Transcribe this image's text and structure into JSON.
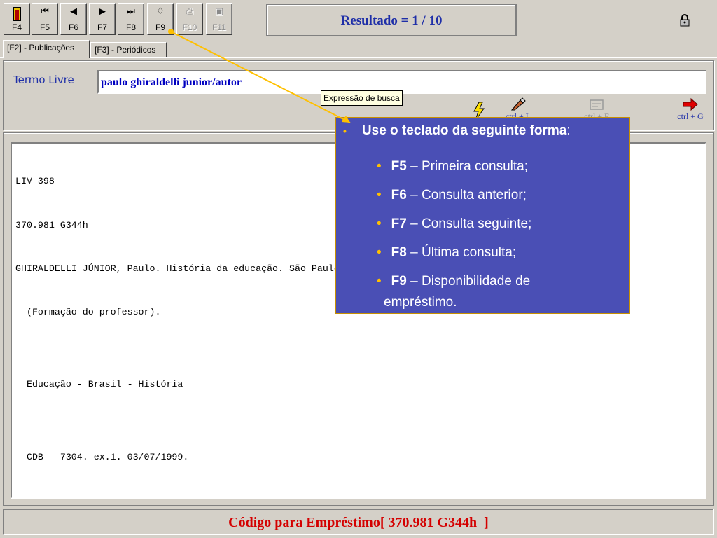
{
  "toolbar": {
    "buttons": [
      {
        "key": "F4",
        "icon": "exit-door-icon"
      },
      {
        "key": "F5",
        "icon": "first-icon",
        "glyph": "⏮"
      },
      {
        "key": "F6",
        "icon": "previous-icon",
        "glyph": "◀"
      },
      {
        "key": "F7",
        "icon": "next-icon",
        "glyph": "▶"
      },
      {
        "key": "F8",
        "icon": "last-icon",
        "glyph": "⏭"
      },
      {
        "key": "F9",
        "icon": "loan-book-icon",
        "glyph": "♢"
      },
      {
        "key": "F10",
        "icon": "print-icon",
        "glyph": "⎙"
      },
      {
        "key": "F11",
        "icon": "save-disk-icon",
        "glyph": "▣"
      }
    ],
    "result": "Resultado = 1 / 10",
    "lock_icon": "lock-icon"
  },
  "tabs": [
    {
      "label": "[F2] - Publicações"
    },
    {
      "label": "[F3] - Periódicos"
    }
  ],
  "search": {
    "label": "Termo Livre",
    "value": "paulo ghiraldelli junior/autor",
    "tooltip": "Expressão de busca",
    "actions": [
      {
        "icon": "lightning-icon",
        "shortcut": ""
      },
      {
        "icon": "eraser-pencil-icon",
        "shortcut": "ctrl + L"
      },
      {
        "icon": "filter-disabled-icon",
        "shortcut": "ctrl + F"
      },
      {
        "icon": "red-arrow-icon",
        "shortcut": "ctrl + G"
      }
    ]
  },
  "record": {
    "lines": [
      "LIV-398",
      "370.981 G344h",
      "GHIRALDELLI JÚNIOR, Paulo. História da educação. São Paulo: Cortez, 1991.",
      "  (Formação do professor).",
      "",
      "  Educação - Brasil - História",
      "",
      "  CDB - 7304. ex.1. 03/07/1999."
    ]
  },
  "status_bar": {
    "text": "Código para Empréstimo[ 370.981 G344h  ]"
  },
  "callout": {
    "title": "Use o teclado da seguinte forma",
    "title_suffix": ":",
    "items": [
      {
        "key": "F5",
        "desc": "– Primeira consulta;"
      },
      {
        "key": "F6",
        "desc": "– Consulta anterior;"
      },
      {
        "key": "F7",
        "desc": "– Consulta seguinte;"
      },
      {
        "key": "F8",
        "desc": "– Última consulta;"
      },
      {
        "key": "F9",
        "desc": "– Disponibilidade de"
      }
    ],
    "continuation": "empréstimo."
  },
  "colors": {
    "window_bg": "#d4d0c8",
    "result_text": "#1f2fa8",
    "search_text": "#0000c0",
    "status_text": "#d40000",
    "callout_bg": "#4a4fb5",
    "callout_bullet": "#ffc000",
    "pointer_line": "#ffc000"
  }
}
